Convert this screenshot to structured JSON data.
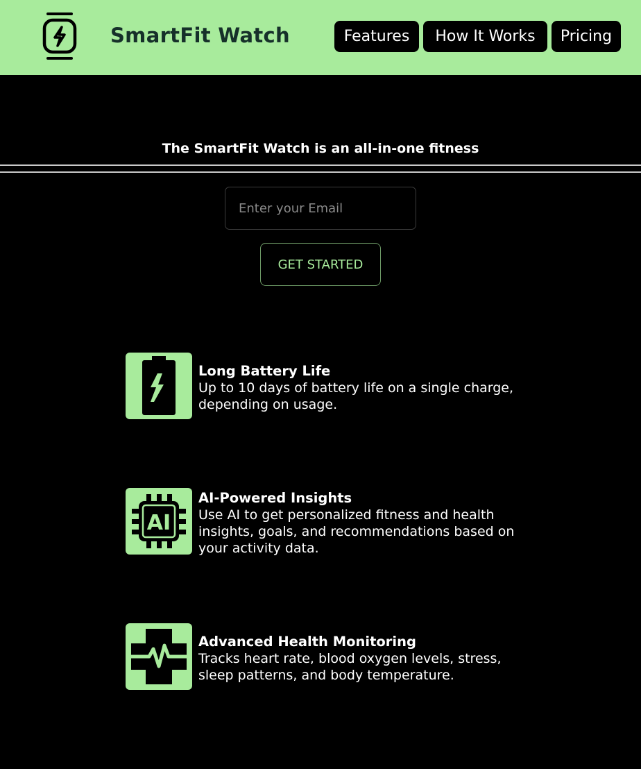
{
  "header": {
    "brand": "SmartFit Watch",
    "logo_icon": "smartwatch-bolt-icon",
    "background": "#a8eb9c",
    "nav": [
      {
        "label": "Features"
      },
      {
        "label": "How It Works"
      },
      {
        "label": "Pricing"
      }
    ]
  },
  "hero": {
    "tagline": "The SmartFit Watch is an all-in-one fitness",
    "email_placeholder": "Enter your Email",
    "email_value": "",
    "cta_label": "GET STARTED"
  },
  "features": [
    {
      "icon": "battery-bolt-icon",
      "title": "Long Battery Life",
      "description": "Up to 10 days of battery life on a single charge, depending on usage."
    },
    {
      "icon": "ai-chip-icon",
      "title": "AI-Powered Insights",
      "description": "Use AI to get personalized fitness and health insights, goals, and recommendations based on your activity data."
    },
    {
      "icon": "health-cross-pulse-icon",
      "title": "Advanced Health Monitoring",
      "description": "Tracks heart rate, blood oxygen levels, stress, sleep patterns, and body temperature."
    }
  ],
  "colors": {
    "accent": "#a8eb9c",
    "page_background": "#000000",
    "brand_text": "#16302a"
  }
}
